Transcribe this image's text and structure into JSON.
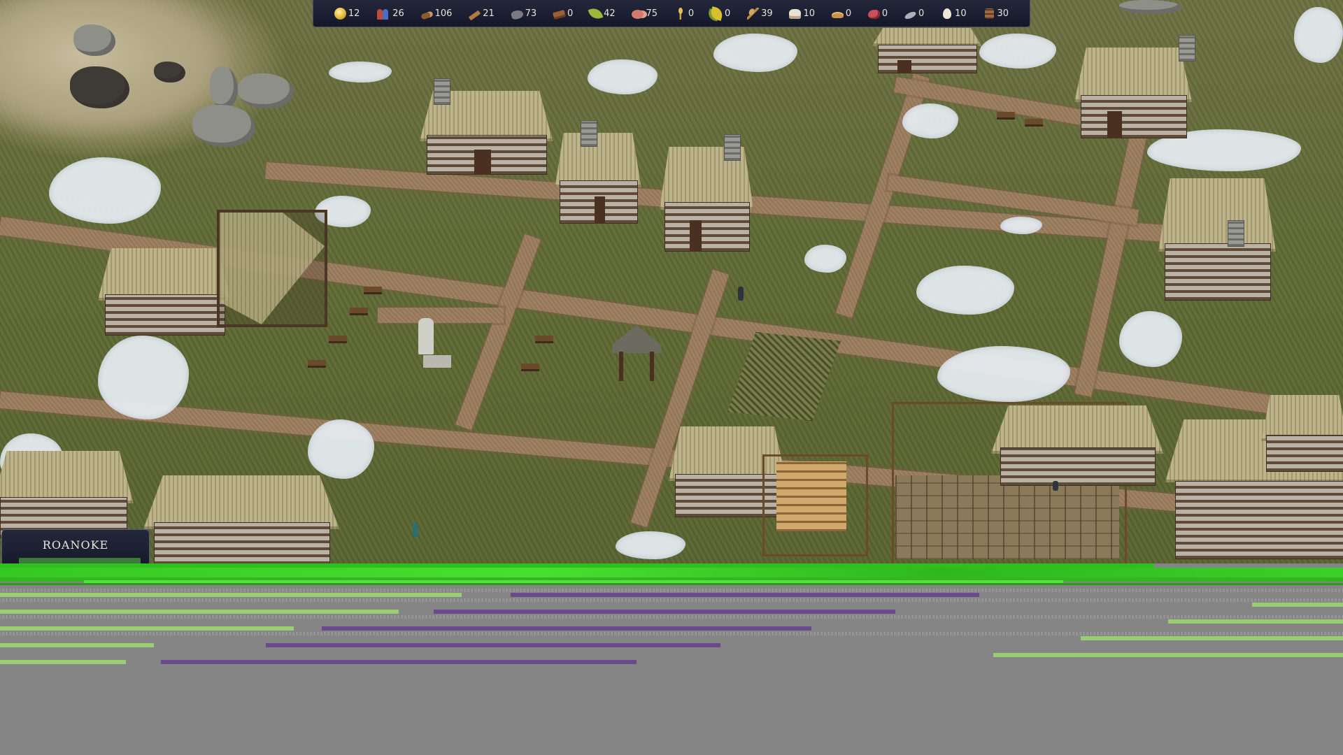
{
  "resources": [
    {
      "id": "coin",
      "icon": "coin-icon",
      "value": "12"
    },
    {
      "id": "population",
      "icon": "people-icon",
      "value": "26"
    },
    {
      "id": "logs",
      "icon": "log-icon",
      "value": "106"
    },
    {
      "id": "firewood",
      "icon": "plank-icon",
      "value": "21"
    },
    {
      "id": "stone",
      "icon": "stone-icon",
      "value": "73"
    },
    {
      "id": "tools",
      "icon": "crate-icon",
      "value": "0"
    },
    {
      "id": "vegetables",
      "icon": "leaf-icon",
      "value": "42"
    },
    {
      "id": "meat",
      "icon": "meat-icon",
      "value": "75"
    },
    {
      "id": "wheat",
      "icon": "wheat-icon",
      "value": "0"
    },
    {
      "id": "herbs",
      "icon": "herb-icon",
      "value": "0"
    },
    {
      "id": "grain",
      "icon": "grain-icon",
      "value": "39"
    },
    {
      "id": "flour",
      "icon": "flour-icon",
      "value": "10"
    },
    {
      "id": "bread",
      "icon": "bread-icon",
      "value": "0"
    },
    {
      "id": "ham",
      "icon": "ham-icon",
      "value": "0"
    },
    {
      "id": "fish",
      "icon": "fish-icon",
      "value": "0"
    },
    {
      "id": "eggs",
      "icon": "egg-icon",
      "value": "10"
    },
    {
      "id": "barrels",
      "icon": "barrel-icon",
      "value": "30"
    }
  ],
  "region": {
    "name": "ROANOKE"
  },
  "colors": {
    "hud_bg": "#1a1d2e",
    "hud_border": "#4a4e63",
    "glitch_green": "#3ccf2a",
    "glitch_purple": "#6a4a8a",
    "glitch_light_green": "#9acd72"
  }
}
